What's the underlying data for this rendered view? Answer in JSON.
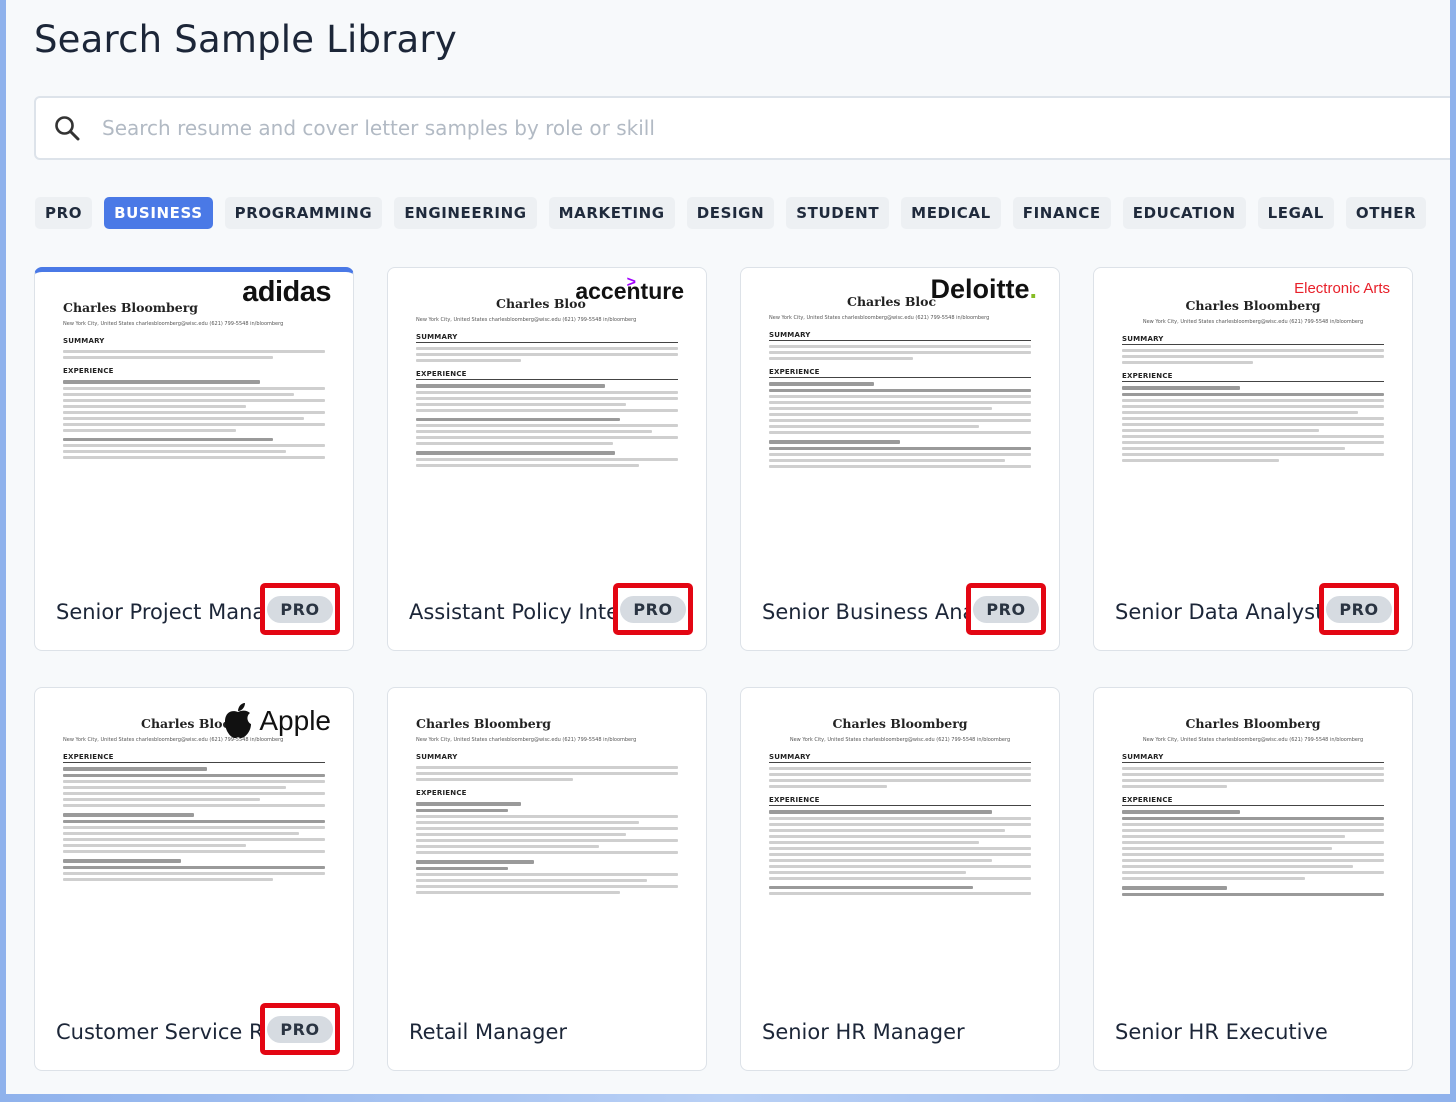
{
  "header": {
    "title": "Search Sample Library"
  },
  "search": {
    "placeholder": "Search resume and cover letter samples by role or skill"
  },
  "categories": [
    "PRO",
    "BUSINESS",
    "PROGRAMMING",
    "ENGINEERING",
    "MARKETING",
    "DESIGN",
    "STUDENT",
    "MEDICAL",
    "FINANCE",
    "EDUCATION",
    "LEGAL",
    "OTHER"
  ],
  "active_category": "BUSINESS",
  "pro_label": "PRO",
  "resume": {
    "name": "Charles Bloomberg",
    "name_trunc": "Charles Bloo",
    "name_trunc2": "Charles Bloc",
    "name_trunc3": "Charles Bloom",
    "contact": "New York City, United States   charlesbloomberg@wisc.edu   (621) 799-5548   in/bloomberg",
    "summary": "SUMMARY",
    "experience": "EXPERIENCE"
  },
  "logos": {
    "adidas": "adidas",
    "accenture": "accenture",
    "deloitte": "Deloitte",
    "ea": "Electronic Arts",
    "apple": "Apple"
  },
  "samples": [
    {
      "title": "Senior Project Manager",
      "pro": true
    },
    {
      "title": "Assistant Policy Intern",
      "pro": true
    },
    {
      "title": "Senior Business Analyst",
      "pro": true
    },
    {
      "title": "Senior Data Analyst",
      "pro": true
    },
    {
      "title": "Customer Service Rep.",
      "pro": true
    },
    {
      "title": "Retail Manager",
      "pro": false
    },
    {
      "title": "Senior HR Manager",
      "pro": false
    },
    {
      "title": "Senior HR Executive",
      "pro": false
    }
  ],
  "colors": {
    "accent": "#4a79e6",
    "highlight": "#e30613",
    "ea": "#e8202a",
    "deloitte_dot": "#86bc25",
    "accenture": "#a100ff"
  }
}
